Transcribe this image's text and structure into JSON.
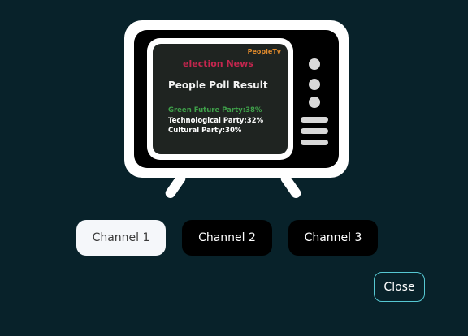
{
  "tv": {
    "brand": "PeopleTv",
    "news_title": "election News",
    "poll_title": "People Poll Result",
    "results": [
      {
        "text": "Green Future Party:38%",
        "color": "#3fa04a"
      },
      {
        "text": "Technological Party:32%",
        "color": "#ffffff"
      },
      {
        "text": "Cultural Party:30%",
        "color": "#ffffff"
      }
    ]
  },
  "channels": [
    {
      "label": "Channel 1",
      "active": true
    },
    {
      "label": "Channel 2",
      "active": false
    },
    {
      "label": "Channel 3",
      "active": false
    }
  ],
  "close_label": "Close",
  "colors": {
    "background": "#08222a",
    "brand": "#e08a2c",
    "news_title": "#c4264e",
    "close_border": "#56c8d2"
  }
}
